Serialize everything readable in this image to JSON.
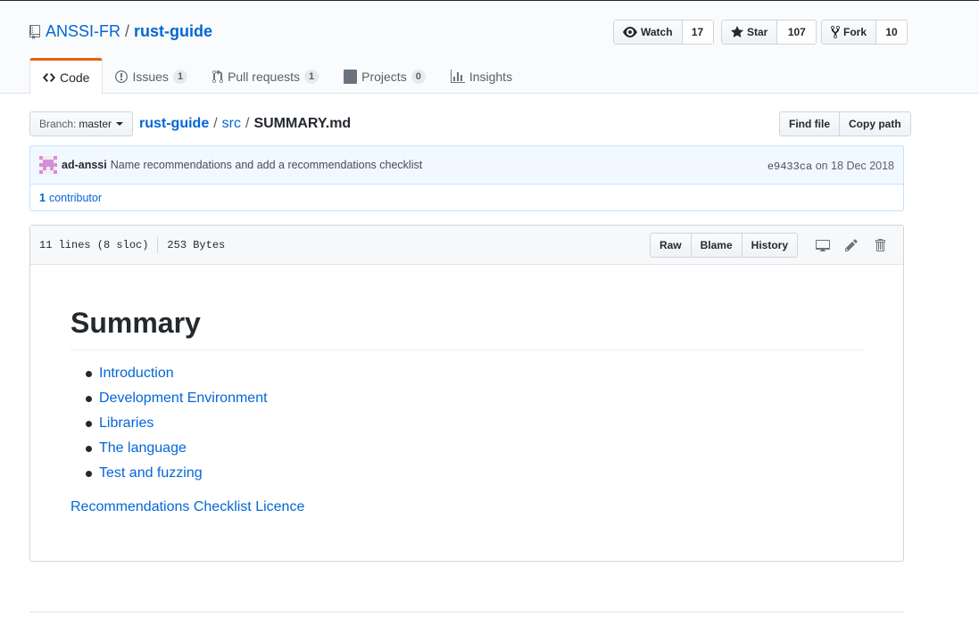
{
  "repo": {
    "owner": "ANSSI-FR",
    "separator": "/",
    "name": "rust-guide"
  },
  "actions": {
    "watch": {
      "label": "Watch",
      "count": "17",
      "icon": "eye-icon"
    },
    "star": {
      "label": "Star",
      "count": "107",
      "icon": "star-icon"
    },
    "fork": {
      "label": "Fork",
      "count": "10",
      "icon": "fork-icon"
    }
  },
  "tabs": [
    {
      "label": "Code",
      "icon": "code-icon",
      "selected": true
    },
    {
      "label": "Issues",
      "counter": "1",
      "icon": "issue-icon"
    },
    {
      "label": "Pull requests",
      "counter": "1",
      "icon": "pull-request-icon"
    },
    {
      "label": "Projects",
      "counter": "0",
      "icon": "project-icon"
    },
    {
      "label": "Insights",
      "icon": "graph-icon"
    }
  ],
  "branch": {
    "prefix": "Branch:",
    "name": "master"
  },
  "breadcrumb": {
    "root": "rust-guide",
    "sep": "/",
    "dir": "src",
    "file": "SUMMARY.md"
  },
  "file_nav": {
    "find_file": "Find file",
    "copy_path": "Copy path"
  },
  "commit": {
    "author": "ad-anssi",
    "message": "Name recommendations and add a recommendations checklist",
    "sha": "e9433ca",
    "date_text": "on 18 Dec 2018",
    "contributors_count": "1",
    "contributors_label": "contributor"
  },
  "file": {
    "lines": "11 lines (8 sloc)",
    "size": "253 Bytes",
    "raw": "Raw",
    "blame": "Blame",
    "history": "History"
  },
  "content": {
    "heading": "Summary",
    "items": [
      "Introduction",
      "Development Environment",
      "Libraries",
      "The language",
      "Test and fuzzing"
    ],
    "footer_link": "Recommendations Checklist Licence"
  }
}
